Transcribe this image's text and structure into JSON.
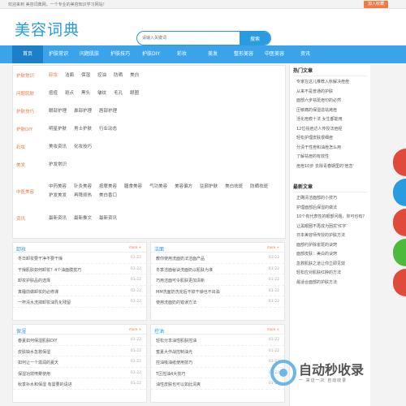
{
  "topbar": {
    "notice": "欢迎来到 美容词典网，一个专业的美容知识学习网站！",
    "fav": "加入收藏"
  },
  "header": {
    "logo": "美容词典",
    "search_placeholder": "请输入关键词",
    "search_button": "搜索"
  },
  "nav": [
    "首页",
    "护肤常识",
    "问题肌肤",
    "护肤技巧",
    "护肤DIY",
    "彩妆",
    "美发",
    "整形美容",
    "中医美容",
    "资讯"
  ],
  "categories": [
    {
      "cat": "护肤常识",
      "links": [
        "卸妆",
        "洁面",
        "保湿",
        "控油",
        "防晒",
        "美白"
      ]
    },
    {
      "cat": "问题肌肤",
      "links": [
        "痘痘",
        "斑点",
        "黑头",
        "皱纹",
        "毛孔",
        "眼圈"
      ]
    },
    {
      "cat": "护肤技巧",
      "links": [
        "眼部护理",
        "鼻部护理",
        "唇部护理"
      ]
    },
    {
      "cat": "护肤DIY",
      "links": [
        "明星护肤",
        "男士护肤",
        "行业动态"
      ]
    },
    {
      "cat": "彩妆",
      "links": [
        "美妆资讯",
        "化妆技巧"
      ]
    },
    {
      "cat": "美发",
      "links": [
        "护发常识"
      ]
    },
    {
      "cat": "中医美容",
      "links": [
        "中药美容",
        "针灸美容",
        "按摩美容",
        "膳食美容",
        "气功美容",
        "美容偏方",
        "驻颜护肤",
        "美白祛斑",
        "防晒祛斑",
        "护发美发",
        "再障烦热",
        "美白香口"
      ]
    },
    {
      "cat": "资讯",
      "links": [
        "最新资讯",
        "最新推文",
        "最新资讯"
      ]
    }
  ],
  "hot": {
    "title": "热门文章",
    "items": [
      "专家在这儿推荐入秋解决痘痘",
      "从来不是普通的护肤",
      "面部六步祛斑痘印的必然",
      "压敏痛的保湿造祛烤痘",
      "活化痘痕十法 女生都能用",
      "12位祛痘达人传授法痘经",
      "轻松护理皮肤很细痘",
      "分清干性痘和油痘怎么用",
      "了解祛痘的有效性",
      "痘痘10步 去除青春期里的'痘恋'"
    ]
  },
  "news": {
    "title": "最新文章",
    "items": [
      "正确清洁面部的小技巧",
      "护理面部后保湿的做法",
      "10个有代表性的眼部问题，你可也有？",
      "让黑眼圈不再成为困扰'红字'",
      "日本美容师传授的护肤方法",
      "面部约护除雀斑的诀窍",
      "面部皮肤：美白的诀窍",
      "急救肌肤之道让你立即见效",
      "轻松应对肌肤红肿的方法",
      "最适合面部的护肤方法"
    ]
  },
  "panels": [
    {
      "title": "卸妆",
      "more": "more +",
      "items": [
        "冬日卸妆要干净不要干燥",
        "干燥肌肤如何卸妆？4个油面膜技巧",
        "卸妆护肤品的选择",
        "真睡前做卸妆的必修课",
        "一杯清水洗掉卸妆油乳化残留"
      ],
      "date": "01-22"
    },
    {
      "title": "洁面",
      "more": "more +",
      "items": [
        "教你使用洗面奶法洁面产品",
        "冬季洁面秘诀洗面奶以肌肤为准",
        "巧用洁面可令肌肤更加清新",
        "MM洗面奶洗完后不掉干燥也不出油",
        "使用洗面奶的错误方法"
      ],
      "date": "01-22"
    },
    {
      "title": "保湿",
      "more": "more +",
      "items": [
        "春夏如何保湿肌肤DIY",
        "皮肤缺水急救保湿",
        "如何让一个滋润的夏天",
        "保湿功效喷雾使用",
        "秋季补水和保湿 有需要的请进"
      ],
      "date": "01-22"
    },
    {
      "title": "控油",
      "more": "more +",
      "items": [
        "轻松分享油性肌肤控油",
        "蜜夏大作战控制油光",
        "控油吸油纸使用技巧",
        "T区控油4大技巧",
        "油性皮肤也可以如此清爽"
      ],
      "date": "01-22"
    }
  ],
  "watermark": {
    "big": "自动秒收录",
    "small": "一 来访一次 自动收录"
  }
}
